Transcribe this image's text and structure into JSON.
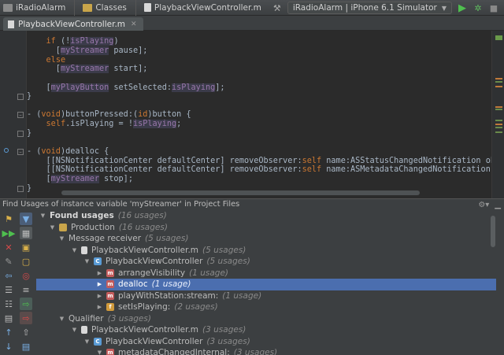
{
  "navbar": {
    "breadcrumbs": [
      "iRadioAlarm",
      "Classes",
      "PlaybackViewController.m"
    ],
    "scheme": "iRadioAlarm | iPhone 6.1 Simulator"
  },
  "tab": {
    "label": "PlaybackViewController.m"
  },
  "code": {
    "lines": [
      "    if (!isPlaying)",
      "      [myStreamer pause];",
      "    else",
      "      [myStreamer start];",
      "",
      "    [myPlayButton setSelected:isPlaying];",
      "}",
      "",
      "- (void)buttonPressed:(id)button {",
      "    self.isPlaying = !isPlaying;",
      "}",
      "",
      "- (void)dealloc {",
      "    [[NSNotificationCenter defaultCenter] removeObserver:self name:ASStatusChangedNotification object:myStreamer];",
      "    [[NSNotificationCenter defaultCenter] removeObserver:self name:ASMetadataChangedNotification object:myStreamer];",
      "    [myStreamer stop];",
      "}"
    ]
  },
  "find": {
    "title": "Find Usages of instance variable 'myStreamer' in Project Files",
    "rows": [
      {
        "label": "Found usages",
        "count": "(16 usages)"
      },
      {
        "label": "Production",
        "count": "(16 usages)"
      },
      {
        "label": "Message receiver",
        "count": "(5 usages)"
      },
      {
        "label": "PlaybackViewController.m",
        "count": "(5 usages)"
      },
      {
        "label": "PlaybackViewController",
        "count": "(5 usages)"
      },
      {
        "label": "arrangeVisibility",
        "count": "(1 usage)"
      },
      {
        "label": "dealloc",
        "count": "(1 usage)"
      },
      {
        "label": "playWithStation:stream:",
        "count": "(1 usage)"
      },
      {
        "label": "setIsPlaying:",
        "count": "(2 usages)"
      },
      {
        "label": "Qualifier",
        "count": "(3 usages)"
      },
      {
        "label": "PlaybackViewController.m",
        "count": "(3 usages)"
      },
      {
        "label": "PlaybackViewController",
        "count": "(3 usages)"
      },
      {
        "label": "metadataChangedInternal:",
        "count": "(3 usages)"
      }
    ]
  }
}
